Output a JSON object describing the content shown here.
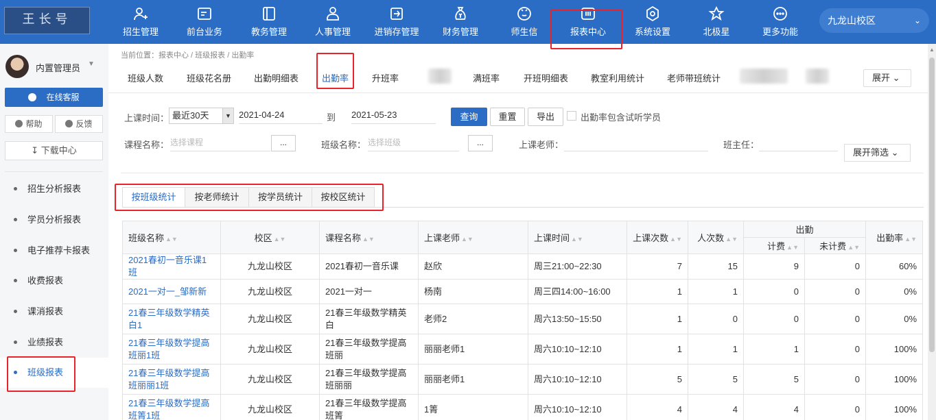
{
  "logo_text": "王长号",
  "nav": {
    "items": [
      {
        "label": "招生管理",
        "icon": "user-plus-icon"
      },
      {
        "label": "前台业务",
        "icon": "id-card-icon"
      },
      {
        "label": "教务管理",
        "icon": "book-icon"
      },
      {
        "label": "人事管理",
        "icon": "person-icon"
      },
      {
        "label": "进销存管理",
        "icon": "import-box-icon"
      },
      {
        "label": "财务管理",
        "icon": "money-bag-icon"
      },
      {
        "label": "师生信",
        "icon": "chat-icon"
      },
      {
        "label": "报表中心",
        "icon": "report-icon"
      },
      {
        "label": "系统设置",
        "icon": "gear-icon"
      },
      {
        "label": "北极星",
        "icon": "star-icon"
      },
      {
        "label": "更多功能",
        "icon": "more-icon"
      }
    ],
    "campus": "九龙山校区"
  },
  "sidebar": {
    "user_name": "内置管理员",
    "service_button": "在线客服",
    "help_button": "帮助",
    "feedback_button": "反馈",
    "download_button": "下载中心",
    "items": [
      "招生分析报表",
      "学员分析报表",
      "电子推荐卡报表",
      "收费报表",
      "课消报表",
      "业绩报表",
      "班级报表"
    ]
  },
  "breadcrumb": "当前位置：报表中心 / 班级报表 / 出勤率",
  "subtabs": [
    "班级人数",
    "班级花名册",
    "出勤明细表",
    "出勤率",
    "升班率",
    "满班率",
    "开班明细表",
    "教室利用统计",
    "老师带班统计"
  ],
  "expand_label": "展开",
  "filters": {
    "time_label": "上课时间：",
    "range_select": "最近30天",
    "start_date": "2021-04-24",
    "to_label": "到",
    "end_date": "2021-05-23",
    "query_button": "查询",
    "reset_button": "重置",
    "export_button": "导出",
    "trial_checkbox_label": "出勤率包含试听学员",
    "course_label": "课程名称：",
    "course_placeholder": "选择课程",
    "class_label": "班级名称：",
    "class_placeholder": "选择班级",
    "dots": "...",
    "teacher_label": "上课老师：",
    "head_teacher_label": "班主任：",
    "expand_filter_button": "展开筛选"
  },
  "stat_tabs": [
    "按班级统计",
    "按老师统计",
    "按学员统计",
    "按校区统计"
  ],
  "table": {
    "headers": {
      "class_name": "班级名称",
      "campus": "校区",
      "course": "课程名称",
      "teacher": "上课老师",
      "time": "上课时间",
      "sessions": "上课次数",
      "person_times": "人次数",
      "attendance": "出勤",
      "billed": "计费",
      "unbilled": "未计费",
      "rate": "出勤率"
    },
    "rows": [
      {
        "class_name": "2021春初一音乐课1班",
        "campus": "九龙山校区",
        "course": "2021春初一音乐课",
        "teacher": "赵欣",
        "time": "周三21:00~22:30",
        "sessions": "7",
        "person_times": "15",
        "billed": "9",
        "unbilled": "0",
        "rate": "60%"
      },
      {
        "class_name": "2021一对一_邹新新",
        "campus": "九龙山校区",
        "course": "2021一对一",
        "teacher": "杨南",
        "time": "周三四14:00~16:00",
        "sessions": "1",
        "person_times": "1",
        "billed": "0",
        "unbilled": "0",
        "rate": "0%"
      },
      {
        "class_name": "21春三年级数学精英白1",
        "campus": "九龙山校区",
        "course": "21春三年级数学精英白",
        "teacher": "老师2",
        "time": "周六13:50~15:50",
        "sessions": "1",
        "person_times": "0",
        "billed": "0",
        "unbilled": "0",
        "rate": "0%"
      },
      {
        "class_name": "21春三年级数学提高班丽1班",
        "campus": "九龙山校区",
        "course": "21春三年级数学提高班丽",
        "teacher": "丽丽老师1",
        "time": "周六10:10~12:10",
        "sessions": "1",
        "person_times": "1",
        "billed": "1",
        "unbilled": "0",
        "rate": "100%"
      },
      {
        "class_name": "21春三年级数学提高班丽丽1班",
        "campus": "九龙山校区",
        "course": "21春三年级数学提高班丽丽",
        "teacher": "丽丽老师1",
        "time": "周六10:10~12:10",
        "sessions": "5",
        "person_times": "5",
        "billed": "5",
        "unbilled": "0",
        "rate": "100%"
      },
      {
        "class_name": "21春三年级数学提高班箐1班",
        "campus": "九龙山校区",
        "course": "21春三年级数学提高班箐",
        "teacher": "1箐",
        "time": "周六10:10~12:10",
        "sessions": "4",
        "person_times": "4",
        "billed": "4",
        "unbilled": "0",
        "rate": "100%"
      }
    ]
  }
}
